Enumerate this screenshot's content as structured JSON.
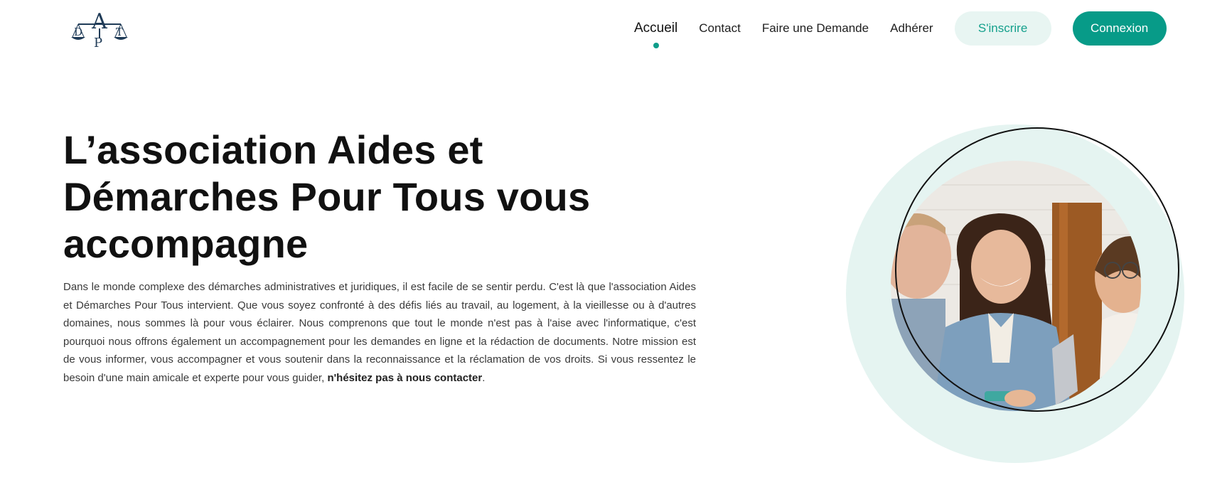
{
  "header": {
    "logo": {
      "letters": [
        "A",
        "D",
        "P",
        "T"
      ],
      "icon": "scales-of-justice-logo"
    },
    "nav": {
      "items": [
        {
          "label": "Accueil",
          "active": true
        },
        {
          "label": "Contact",
          "active": false
        },
        {
          "label": "Faire une Demande",
          "active": false
        },
        {
          "label": "Adhérer",
          "active": false
        }
      ]
    },
    "signup_label": "S'inscrire",
    "login_label": "Connexion"
  },
  "hero": {
    "title": "L’association Aides et Démarches Pour Tous vous accompagne",
    "text": "Dans le monde complexe des démarches administratives et juridiques, il est facile de se sentir perdu. C'est là que l'association Aides et Démarches Pour Tous intervient. Que vous soyez confronté à des défis liés au travail, au logement, à la vieillesse ou à d'autres domaines, nous sommes là pour vous éclairer. Nous comprenons que tout le monde n'est pas à l'aise avec l'informatique, c'est pourquoi nous offrons également un accompagnement pour les demandes en ligne et la rédaction de documents. Notre mission est de vous informer, vous accompagner et vous soutenir dans la reconnaissance et la réclamation de vos droits. Si vous ressentez le besoin d'une main amicale et experte pour vous guider,",
    "text_emphasis": "n'hésitez pas à nous contacter",
    "text_end": "."
  },
  "colors": {
    "accent": "#079b88",
    "accent_light": "#e8f5f2",
    "logo_navy": "#1f3b57",
    "visual_bg": "#e5f4f1"
  }
}
